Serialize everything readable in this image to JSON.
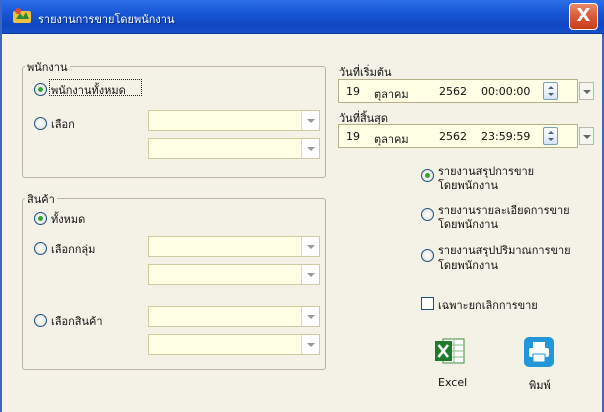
{
  "window": {
    "title": "รายงานการขายโดยพนักงาน",
    "close_label": "X"
  },
  "employee_group": {
    "legend": "พนักงาน",
    "option_all": "พนักงานทั้งหมด",
    "option_select": "เลือก",
    "selected": "all"
  },
  "product_group": {
    "legend": "สินค้า",
    "option_all": "ทั้งหมด",
    "option_group": "เลือกกลุ่ม",
    "option_product": "เลือกสินค้า",
    "selected": "all"
  },
  "start_date": {
    "label": "วันที่เริ่มต้น",
    "day": "19",
    "month": "ตุลาคม",
    "year": "2562",
    "time": "00:00:00"
  },
  "end_date": {
    "label": "วันที่สิ้นสุด",
    "day": "19",
    "month": "ตุลาคม",
    "year": "2562",
    "time": "23:59:59"
  },
  "report_types": [
    {
      "line1": "รายงานสรุปการขาย",
      "line2": "โดยพนักงาน",
      "checked": true
    },
    {
      "line1": "รายงานรายละเอียดการขาย",
      "line2": "โดยพนักงาน",
      "checked": false
    },
    {
      "line1": "รายงานสรุปปริมาณการขาย",
      "line2": "โดยพนักงาน",
      "checked": false
    }
  ],
  "cancelled_only": {
    "label": "เฉพาะยกเลิกการขาย",
    "checked": false
  },
  "buttons": {
    "excel_label": "Excel",
    "print_label": "พิมพ์"
  },
  "colors": {
    "titlebar": "#1856d6",
    "close": "#d9562f",
    "window_bg": "#f4f2e6",
    "input_bg": "#ffffe6",
    "radio_dot": "#31a531"
  },
  "icons": {
    "app": "app-logo-icon",
    "excel": "excel-icon",
    "print": "printer-icon"
  }
}
